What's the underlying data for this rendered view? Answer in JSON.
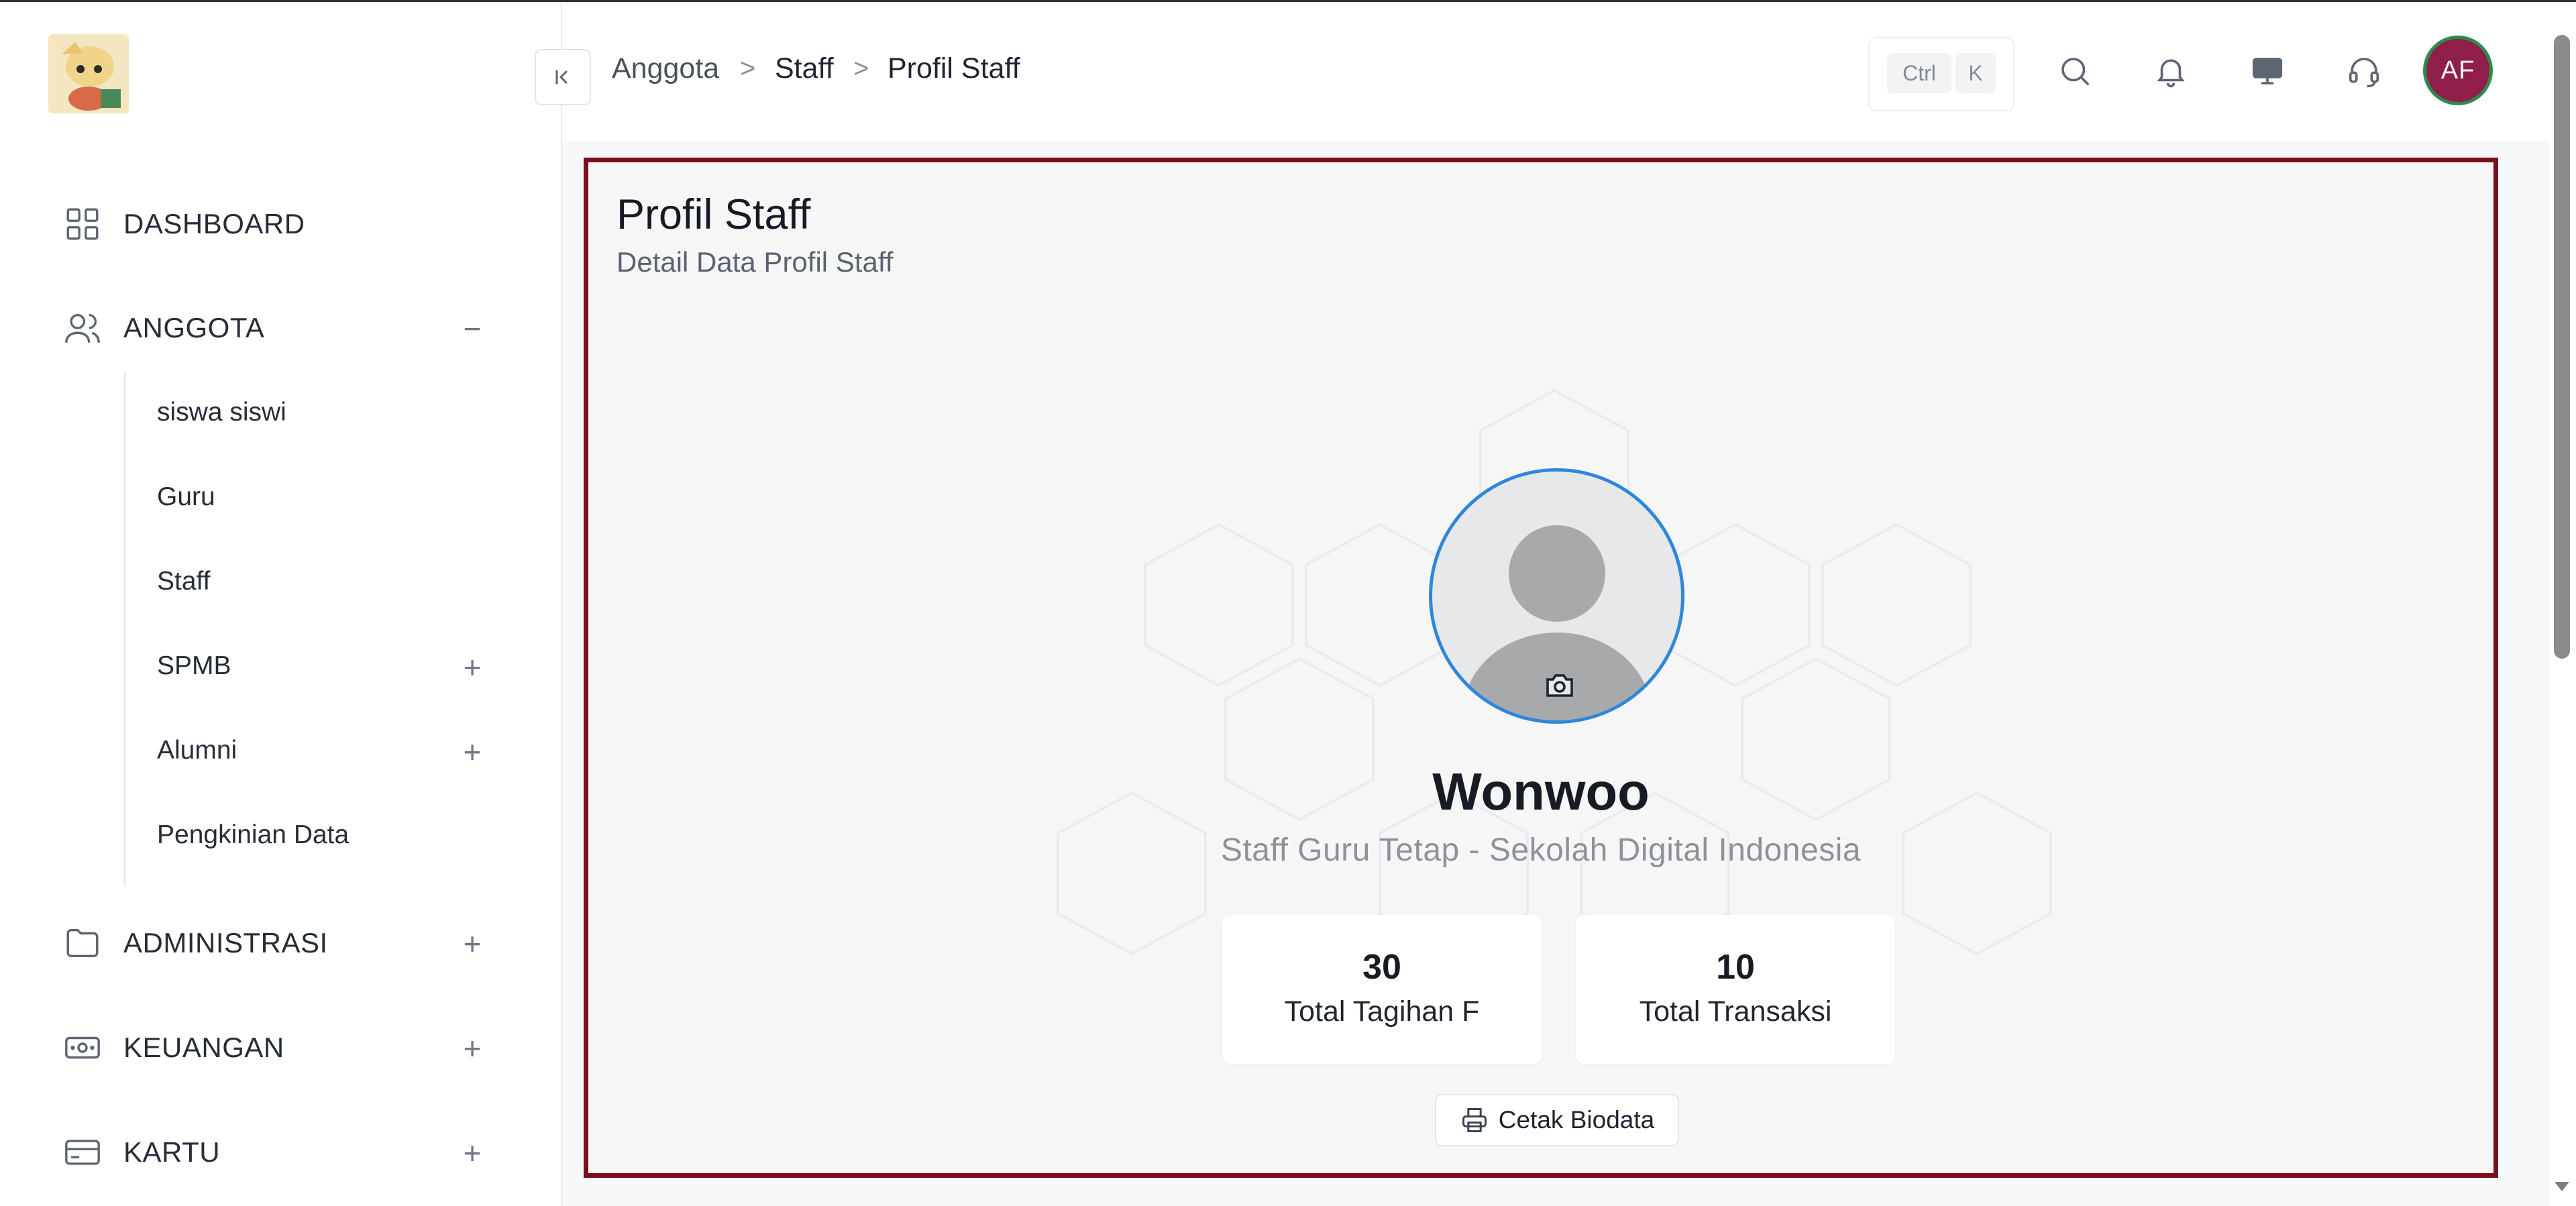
{
  "sidebar": {
    "items": [
      {
        "label": "DASHBOARD",
        "icon": "grid-icon",
        "toggle": ""
      },
      {
        "label": "ANGGOTA",
        "icon": "users-icon",
        "toggle": "−"
      },
      {
        "label": "ADMINISTRASI",
        "icon": "folder-icon",
        "toggle": "+"
      },
      {
        "label": "KEUANGAN",
        "icon": "banknote-icon",
        "toggle": "+"
      },
      {
        "label": "KARTU",
        "icon": "card-icon",
        "toggle": "+"
      }
    ],
    "subitems": [
      {
        "label": "siswa siswi",
        "toggle": ""
      },
      {
        "label": "Guru",
        "toggle": ""
      },
      {
        "label": "Staff",
        "toggle": ""
      },
      {
        "label": "SPMB",
        "toggle": "+"
      },
      {
        "label": "Alumni",
        "toggle": "+"
      },
      {
        "label": "Pengkinian Data",
        "toggle": ""
      }
    ]
  },
  "header": {
    "breadcrumb": [
      "Anggota",
      "Staff",
      "Profil Staff"
    ],
    "breadcrumb_separator": ">",
    "shortcut_keys": [
      "Ctrl",
      "K"
    ],
    "icons": [
      "search-icon",
      "bell-icon",
      "monitor-icon",
      "headset-icon"
    ],
    "avatar_initials": "AF",
    "colors": {
      "avatar_bg": "#8f1e4b",
      "avatar_ring": "#2f8a4a"
    }
  },
  "main": {
    "title": "Profil Staff",
    "subtitle": "Detail Data Profil Staff",
    "profile": {
      "name": "Wonwoo",
      "role": "Staff Guru Tetap - Sekolah Digital Indonesia"
    },
    "stats": [
      {
        "value": "30",
        "label": "Total Tagihan F"
      },
      {
        "value": "10",
        "label": "Total Transaksi"
      }
    ],
    "print_button": "Cetak Biodata",
    "colors": {
      "panel_border": "#7a0f1c",
      "photo_ring": "#2f86dc"
    }
  }
}
